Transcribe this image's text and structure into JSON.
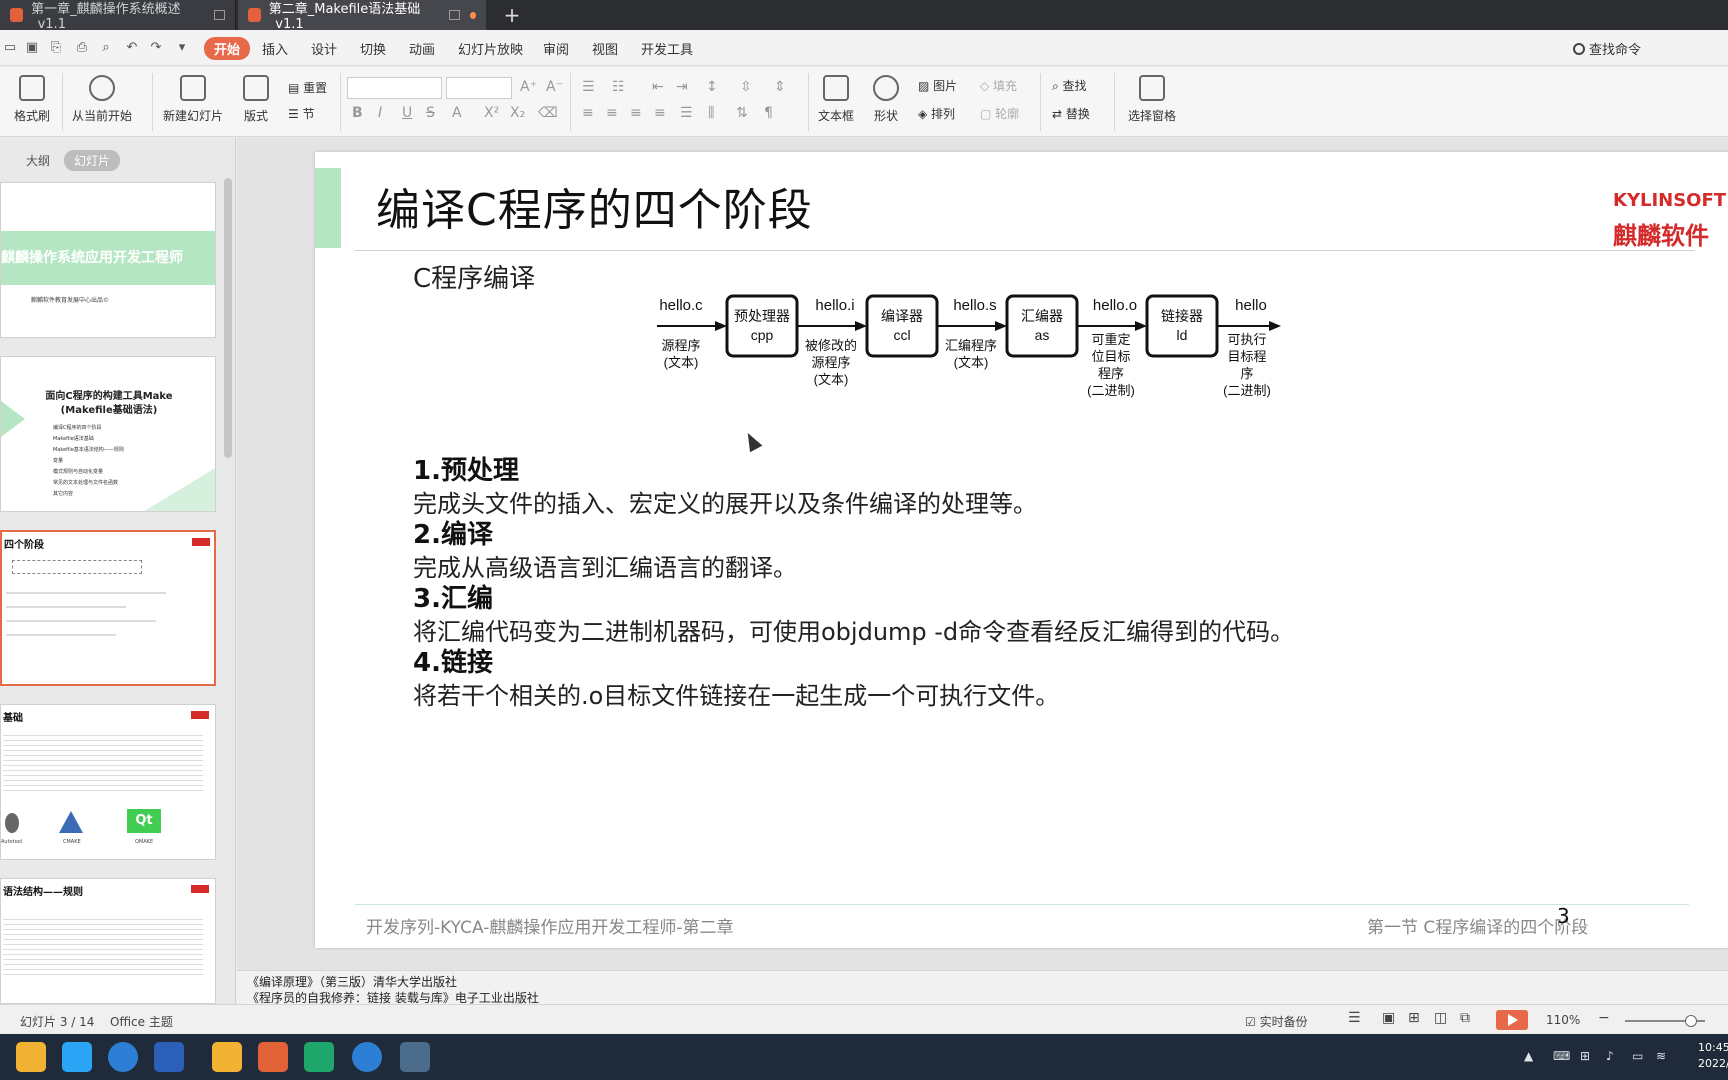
{
  "tabs": [
    {
      "label": "第一章_麒麟操作系统概述_v1.1"
    },
    {
      "label": "第二章_Makefile语法基础_v1.1"
    }
  ],
  "new_tab": "+",
  "menu": [
    "开始",
    "插入",
    "设计",
    "切换",
    "动画",
    "幻灯片放映",
    "审阅",
    "视图",
    "开发工具"
  ],
  "search_cmd": "查找命令",
  "ribbon": {
    "format_brush": "格式刷",
    "from_current": "从当前开始",
    "new_slide": "新建幻灯片",
    "layout": "版式",
    "reset": "重置",
    "section": "节",
    "textbox": "文本框",
    "shape": "形状",
    "picture": "图片",
    "arrange": "排列",
    "fill": "填充",
    "outline": "轮廓",
    "find": "查找",
    "replace": "替换",
    "select_pane": "选择窗格",
    "font_styles": [
      "B",
      "I",
      "U",
      "S",
      "A",
      "X²",
      "X₂"
    ],
    "font_size_buttons": [
      "A⁺",
      "A⁻"
    ]
  },
  "left_panel": {
    "tab_outline": "大纲",
    "tab_slides": "幻灯片",
    "thumb1_title": "麒麟操作系统应用开发工程师",
    "thumb1_sub": "麒麟软件教育发展中心出品©",
    "thumb2_title": "面向C程序的构建工具Make",
    "thumb2_sub": "(Makefile基础语法)",
    "thumb2_items": [
      "编译C程序的四个阶段",
      "Makefile语法基础",
      "Makefile基本语法结构——规则",
      "变量",
      "模式规则与自动化变量",
      "常见的文本处理与文件名函数",
      "其它内容"
    ],
    "thumb3_title": "四个阶段",
    "thumb4_title": "基础",
    "thumb4_labels": [
      "Autotool",
      "CMAKE",
      "QMAKE"
    ],
    "thumb5_title": "语法结构——规则"
  },
  "slide": {
    "title": "编译C程序的四个阶段",
    "logo_en": "KYLINSOFT",
    "logo_cn": "麒麟软件",
    "subtitle": "C程序编译",
    "diagram": {
      "boxes": [
        {
          "l1": "预处理器",
          "l2": "cpp"
        },
        {
          "l1": "编译器",
          "l2": "ccl"
        },
        {
          "l1": "汇编器",
          "l2": "as"
        },
        {
          "l1": "链接器",
          "l2": "ld"
        }
      ],
      "files": [
        "hello.c",
        "hello.i",
        "hello.s",
        "hello.o",
        "hello"
      ],
      "desc": [
        [
          "源程序",
          "(文本)"
        ],
        [
          "被修改的",
          "源程序",
          "(文本)"
        ],
        [
          "汇编程序",
          "(文本)"
        ],
        [
          "可重定",
          "位目标",
          "程序",
          "(二进制)"
        ],
        [
          "可执行",
          "目标程",
          "序",
          "(二进制)"
        ]
      ]
    },
    "sections": [
      {
        "h": "1.预处理",
        "b": "完成头文件的插入、宏定义的展开以及条件编译的处理等。"
      },
      {
        "h": "2.编译",
        "b": "完成从高级语言到汇编语言的翻译。"
      },
      {
        "h": "3.汇编",
        "b": "将汇编代码变为二进制机器码，可使用objdump -d命令查看经反汇编得到的代码。"
      },
      {
        "h": "4.链接",
        "b": "将若干个相关的.o目标文件链接在一起生成一个可执行文件。"
      }
    ],
    "footer_left": "开发序列-KYCA-麒麟操作应用开发工程师-第二章",
    "footer_right": "第一节 C程序编译的四个阶段",
    "page": "3"
  },
  "notes": [
    "《编译原理》（第三版）清华大学出版社",
    "《程序员的自我修养：链接 装载与库》电子工业出版社"
  ],
  "status": {
    "slide_count": "幻灯片 3 / 14",
    "theme": "Office 主题",
    "backup": "实时备份",
    "zoom": "110%"
  },
  "clock": {
    "time": "10:45",
    "date": "2022/"
  }
}
